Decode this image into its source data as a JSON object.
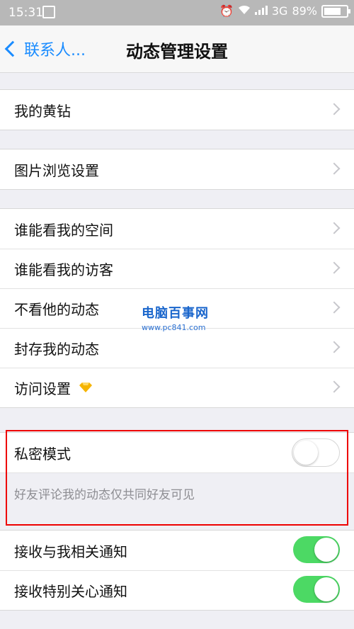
{
  "status": {
    "time": "15:31",
    "network": "3G",
    "battery": "89%",
    "battery_level": 0.89
  },
  "nav": {
    "back_label": "联系人...",
    "title": "动态管理设置"
  },
  "groups": [
    {
      "items": [
        {
          "label": "我的黄钻"
        }
      ]
    },
    {
      "items": [
        {
          "label": "图片浏览设置"
        }
      ]
    },
    {
      "items": [
        {
          "label": "谁能看我的空间"
        },
        {
          "label": "谁能看我的访客"
        },
        {
          "label": "不看他的动态"
        },
        {
          "label": "封存我的动态"
        },
        {
          "label": "访问设置"
        }
      ]
    }
  ],
  "private_mode": {
    "label": "私密模式",
    "enabled": false,
    "description": "好友评论我的动态仅共同好友可见"
  },
  "notifications": [
    {
      "label": "接收与我相关通知",
      "enabled": true
    },
    {
      "label": "接收特别关心通知",
      "enabled": true
    }
  ],
  "watermark": {
    "line1": "电脑百事网",
    "line2": "www.pc841.com"
  },
  "colors": {
    "accent": "#1a8cff",
    "switch_on": "#4cd964",
    "highlight": "#e00000"
  }
}
